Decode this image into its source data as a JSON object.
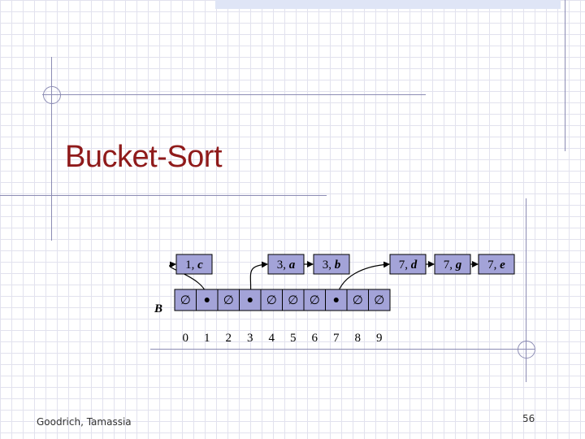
{
  "slide": {
    "title": "Bucket-Sort",
    "footer_left": "Goodrich, Tamassia",
    "page_number": "56"
  },
  "colors": {
    "title": "#8f1a1a",
    "cell_fill": "#a3a3d8",
    "decoration": "#8c8cb4",
    "grid": "#e2e2ee"
  },
  "diagram": {
    "array_label": "B",
    "empty_symbol": "∅",
    "indices": [
      "0",
      "1",
      "2",
      "3",
      "4",
      "5",
      "6",
      "7",
      "8",
      "9"
    ],
    "buckets": [
      {
        "index": "0",
        "entries": []
      },
      {
        "index": "1",
        "entries": [
          {
            "key": "1",
            "value": "c"
          }
        ]
      },
      {
        "index": "2",
        "entries": []
      },
      {
        "index": "3",
        "entries": [
          {
            "key": "3",
            "value": "a"
          },
          {
            "key": "3",
            "value": "b"
          }
        ]
      },
      {
        "index": "4",
        "entries": []
      },
      {
        "index": "5",
        "entries": []
      },
      {
        "index": "6",
        "entries": []
      },
      {
        "index": "7",
        "entries": [
          {
            "key": "7",
            "value": "d"
          },
          {
            "key": "7",
            "value": "g"
          },
          {
            "key": "7",
            "value": "e"
          }
        ]
      },
      {
        "index": "8",
        "entries": []
      },
      {
        "index": "9",
        "entries": []
      }
    ]
  }
}
